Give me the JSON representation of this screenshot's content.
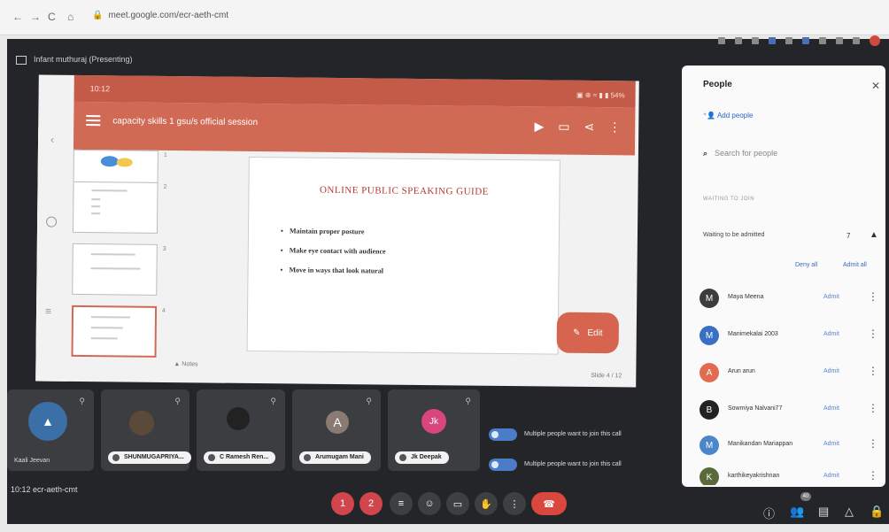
{
  "browser": {
    "nav": [
      "←",
      "→",
      "C",
      "⌂"
    ],
    "url": "meet.google.com/ecr-aeth-cmt"
  },
  "meet": {
    "presenting_label": "Infant muthuraj (Presenting)",
    "bottom_left": "10:12  ecr-aeth-cmt"
  },
  "presentation": {
    "status_time": "10:12",
    "status_right": "▣ ⊕ ≈ ▮ ▮ 54%",
    "doc_title": "capacity skills 1 gsu/s official session",
    "slide_title": "ONLINE PUBLIC SPEAKING GUIDE",
    "bullets": [
      "Maintain proper posture",
      "Make eye contact with audience",
      "Move in ways that look natural"
    ],
    "edit_label": "Edit",
    "notes_label": "▲ Notes",
    "page_label": "Slide 4 / 12",
    "thumb_numbers": [
      "1",
      "2",
      "3",
      "4"
    ]
  },
  "tiles": [
    {
      "name": "Kaali Jeevan",
      "avatar": "",
      "color": "#3a6fa8"
    },
    {
      "name": "SHUNMUGAPRIYA...",
      "avatar": "",
      "color": "#5b4a3a"
    },
    {
      "name": "C Ramesh Ren...",
      "avatar": "",
      "color": "#222222"
    },
    {
      "name": "Arumugam Mani",
      "avatar": "A",
      "color": "#8a7a72"
    },
    {
      "name": "Jk Deepak",
      "avatar": "Jk",
      "color": "#d9467e"
    }
  ],
  "notifications": [
    "Multiple people want to join this call",
    "Multiple people want to join this call"
  ],
  "people_panel": {
    "title": "People",
    "add_people": "Add people",
    "search_placeholder": "Search for people",
    "section": "WAITING TO JOIN",
    "waiting_label": "Waiting to be admitted",
    "waiting_count": "7",
    "deny_all": "Deny all",
    "admit_all": "Admit all",
    "admit_label": "Admit",
    "people": [
      {
        "initial": "M",
        "name": "Maya Meena",
        "color": "#3c3c3c"
      },
      {
        "initial": "M",
        "name": "Manimekalai 2003",
        "color": "#3a6fc4"
      },
      {
        "initial": "A",
        "name": "Arun arun",
        "color": "#e06b4e"
      },
      {
        "initial": "B",
        "name": "Sowmiya Nalvani77",
        "color": "#222222"
      },
      {
        "initial": "M",
        "name": "Manikandan Mariappan",
        "color": "#4a86c8"
      },
      {
        "initial": "K",
        "name": "karthikeyakrishnan",
        "color": "#5a6a3a"
      }
    ]
  },
  "controls": {
    "buttons": [
      "1",
      "2",
      "≡",
      "☺",
      "▭",
      "✋",
      "⋮",
      "☎"
    ],
    "right": [
      "ⓘ",
      "👥",
      "▤",
      "△",
      "🔒"
    ],
    "badge": "40"
  }
}
